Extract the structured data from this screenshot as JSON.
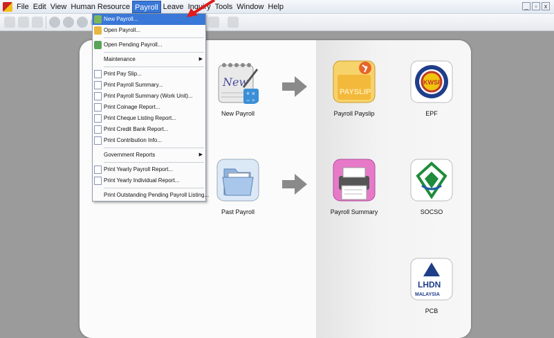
{
  "menubar": {
    "items": [
      "File",
      "Edit",
      "View",
      "Human Resource",
      "Payroll",
      "Leave",
      "Inquiry",
      "Tools",
      "Window",
      "Help"
    ],
    "active_index": 4,
    "window_controls": [
      "_",
      "▫",
      "x"
    ]
  },
  "payroll_menu": {
    "items": [
      {
        "label": "New Payroll...",
        "icon": "new-payroll-icon",
        "highlighted": true
      },
      {
        "label": "Open Payroll...",
        "icon": "open-payroll-icon"
      },
      {
        "label": "Open Pending Payroll...",
        "icon": "pending-payroll-icon"
      },
      {
        "label": "Maintenance",
        "submenu": true
      },
      {
        "label": "Print Pay Slip...",
        "icon": "report-icon"
      },
      {
        "label": "Print Payroll Summary...",
        "icon": "report-icon"
      },
      {
        "label": "Print Payroll Summary (Work Unit)...",
        "icon": "report-icon"
      },
      {
        "label": "Print Coinage Report...",
        "icon": "report-icon"
      },
      {
        "label": "Print Cheque Listing Report...",
        "icon": "report-icon"
      },
      {
        "label": "Print Credit Bank Report...",
        "icon": "report-icon"
      },
      {
        "label": "Print Contribution Info...",
        "icon": "report-icon"
      },
      {
        "label": "Government Reports",
        "submenu": true
      },
      {
        "label": "Print Yearly Payroll Report...",
        "icon": "report-icon"
      },
      {
        "label": "Print Yearly Individual Report...",
        "icon": "report-icon"
      },
      {
        "label": "Print Outstanding Pending Payroll Listing..."
      }
    ]
  },
  "tiles": {
    "new_payroll": {
      "label": "New Payroll",
      "icon_text": "New"
    },
    "past_payroll": {
      "label": "Past Payroll"
    },
    "payroll_payslip": {
      "label": "Payroll Payslip",
      "icon_text": "PAYSLIP"
    },
    "payroll_summary": {
      "label": "Payroll Summary"
    },
    "epf": {
      "label": "EPF",
      "icon_text": "KWSP"
    },
    "socso": {
      "label": "SOCSO"
    },
    "pcb": {
      "label": "PCB",
      "icon_text_1": "LHDN",
      "icon_text_2": "MALAYSIA"
    }
  }
}
